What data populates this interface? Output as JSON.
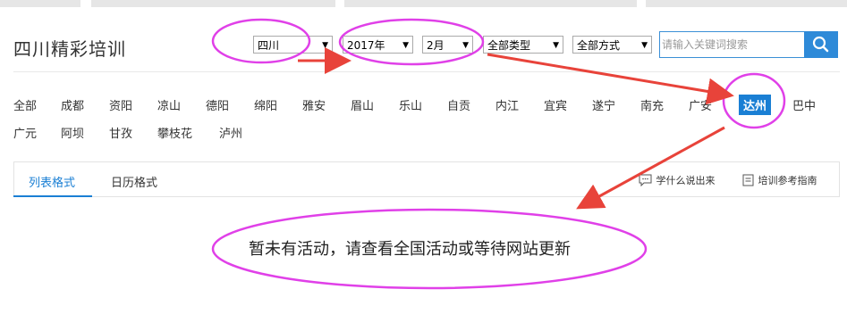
{
  "header": {
    "title": "四川精彩培训"
  },
  "filters": {
    "province": "四川",
    "year": "2017年",
    "month": "2月",
    "type": "全部类型",
    "method": "全部方式",
    "search_placeholder": "请输入关键词搜索"
  },
  "cities_row1": [
    "全部",
    "成都",
    "资阳",
    "凉山",
    "德阳",
    "绵阳",
    "雅安",
    "眉山",
    "乐山",
    "自贡",
    "内江",
    "宜宾",
    "遂宁",
    "南充",
    "广安",
    "达州",
    "巴中"
  ],
  "cities_row2": [
    "广元",
    "阿坝",
    "甘孜",
    "攀枝花",
    "泸州"
  ],
  "active_city": "达州",
  "tabs": {
    "list": "列表格式",
    "calendar": "日历格式"
  },
  "tools": {
    "speak": "学什么说出来",
    "guide": "培训参考指南"
  },
  "empty_message": "暂未有活动，请查看全国活动或等待网站更新",
  "colors": {
    "accent": "#1a7fd4",
    "annotation_ellipse": "#e040e8",
    "annotation_arrow": "#e8433a"
  }
}
